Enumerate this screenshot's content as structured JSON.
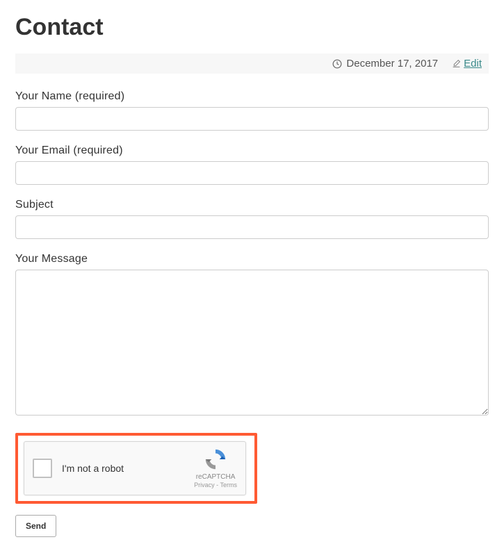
{
  "page": {
    "title": "Contact"
  },
  "meta": {
    "date": "December 17, 2017",
    "edit_label": "Edit"
  },
  "form": {
    "name_label": "Your Name (required)",
    "email_label": "Your Email (required)",
    "subject_label": "Subject",
    "message_label": "Your Message",
    "name_value": "",
    "email_value": "",
    "subject_value": "",
    "message_value": ""
  },
  "captcha": {
    "label": "I'm not a robot",
    "brand": "reCAPTCHA",
    "privacy": "Privacy",
    "terms": "Terms",
    "separator": " - "
  },
  "actions": {
    "send_label": "Send"
  }
}
